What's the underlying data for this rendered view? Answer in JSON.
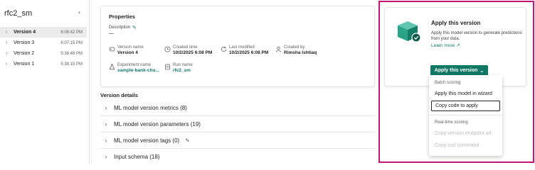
{
  "sidebar": {
    "title": "rfc2_sm",
    "collapse_icon": "chevron-left-icon",
    "versions": [
      {
        "name": "Version 4",
        "time": "6:08:42 PM",
        "selected": true
      },
      {
        "name": "Version 3",
        "time": "6:07:15 PM",
        "selected": false
      },
      {
        "name": "Version 2",
        "time": "5:38:48 PM",
        "selected": false
      },
      {
        "name": "Version 1",
        "time": "5:38:15 PM",
        "selected": false
      }
    ]
  },
  "properties": {
    "title": "Properties",
    "description_label": "Description",
    "description_value": "—",
    "fields": {
      "version_name": {
        "label": "Version name",
        "value": "Version 4"
      },
      "created_time": {
        "label": "Created time",
        "value": "10/2/2025 6:08 PM"
      },
      "last_modified": {
        "label": "Last modified",
        "value": "10/2/2025 6:08 PM"
      },
      "created_by": {
        "label": "Created by",
        "value": "Rimsha Ishtiaq"
      },
      "experiment_name": {
        "label": "Experiment name",
        "value": "sample-bank-chu..."
      },
      "run_name": {
        "label": "Run name",
        "value": "rfc2_sm"
      }
    }
  },
  "version_details": {
    "title": "Version details",
    "sections": [
      "ML model version metrics (8)",
      "ML model version parameters (19)",
      "ML model version tags (0)",
      "Input schema (18)"
    ]
  },
  "apply": {
    "title": "Apply this version",
    "description": "Apply this model version to generate predictions from your data.",
    "learn_more": "Learn more",
    "button_label": "Apply this version"
  },
  "menu": {
    "batch_header": "Batch scoring",
    "batch_items": [
      "Apply this model in wizard",
      "Copy code to apply"
    ],
    "realtime_header": "Real-time scoring",
    "realtime_items": [
      "Copy version endpoint url",
      "Copy curl command"
    ]
  },
  "colors": {
    "accent": "#117865",
    "highlight": "#c31673"
  }
}
